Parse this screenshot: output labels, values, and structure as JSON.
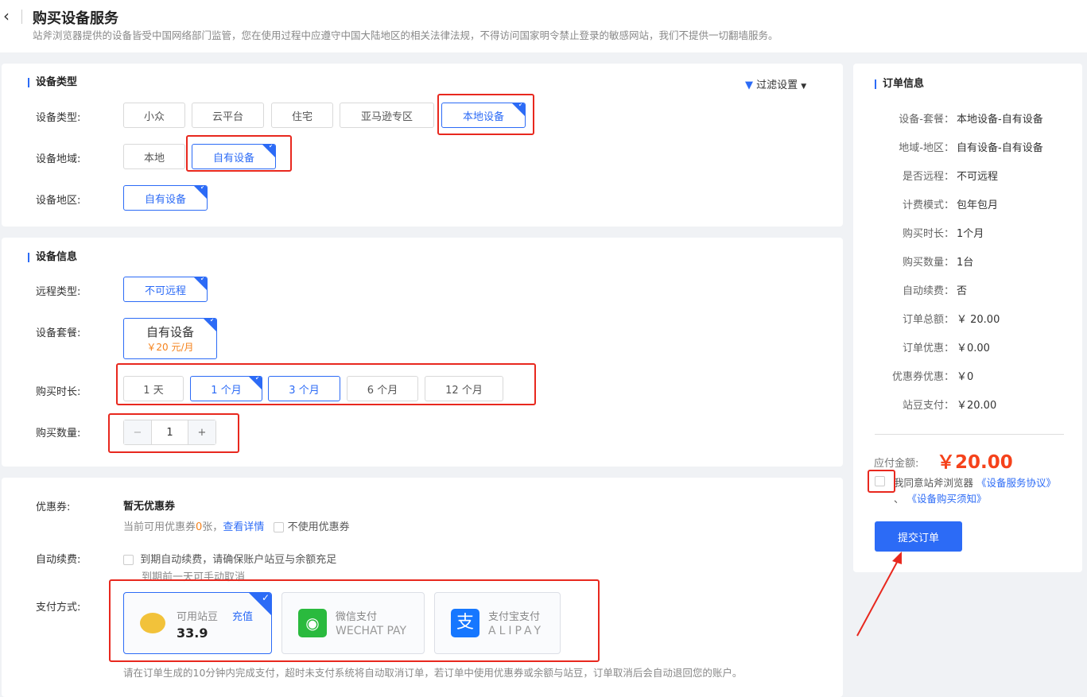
{
  "header": {
    "title": "购买设备服务",
    "notice": "站斧浏览器提供的设备皆受中国网络部门监管，您在使用过程中应遵守中国大陆地区的相关法律法规，不得访问国家明令禁止登录的敏感网站，我们不提供一切翻墙服务。"
  },
  "device_type": {
    "section": "设备类型",
    "filter": "过滤设置",
    "type_label": "设备类型:",
    "types": [
      "小众",
      "云平台",
      "住宅",
      "亚马逊专区",
      "本地设备"
    ],
    "domain_label": "设备地域:",
    "domains": [
      "本地",
      "自有设备"
    ],
    "region_label": "设备地区:",
    "regions": [
      "自有设备"
    ]
  },
  "device_info": {
    "section": "设备信息",
    "remote_label": "远程类型:",
    "remote": "不可远程",
    "package_label": "设备套餐:",
    "package_name": "自有设备",
    "package_price": "￥20 元/月",
    "duration_label": "购买时长:",
    "durations": [
      "1 天",
      "1 个月",
      "3 个月",
      "6 个月",
      "12 个月"
    ],
    "quantity_label": "购买数量:",
    "quantity": "1",
    "minus": "−",
    "plus": "+"
  },
  "payment": {
    "coupon_label": "优惠券:",
    "coupon_none": "暂无优惠券",
    "coupon_prefix": "当前可用优惠券",
    "coupon_count": "0",
    "coupon_suffix": "张，",
    "coupon_link": "查看详情",
    "no_coupon": "不使用优惠券",
    "auto_label": "自动续费:",
    "auto_text": "到期自动续费，请确保账户站豆与余额充足",
    "auto_sub": "到期前一天可手动取消",
    "method_label": "支付方式:",
    "bean_title": "可用站豆",
    "recharge": "充值",
    "bean_amount": "33.9",
    "wechat_title": "微信支付",
    "wechat_en": "WECHAT PAY",
    "alipay_title": "支付宝支付",
    "alipay_en": "ALIPAY",
    "footnote": "请在订单生成的10分钟内完成支付，超时未支付系统将自动取消订单，若订单中使用优惠券或余额与站豆，订单取消后会自动退回您的账户。"
  },
  "order": {
    "section": "订单信息",
    "rows": [
      {
        "k": "设备-套餐：",
        "v": "本地设备-自有设备"
      },
      {
        "k": "地域-地区：",
        "v": "自有设备-自有设备"
      },
      {
        "k": "是否远程：",
        "v": "不可远程"
      },
      {
        "k": "计费模式：",
        "v": "包年包月"
      },
      {
        "k": "购买时长：",
        "v": "1个月"
      },
      {
        "k": "购买数量：",
        "v": "1台"
      },
      {
        "k": "自动续费：",
        "v": "否"
      },
      {
        "k": "订单总额：",
        "v": "￥ 20.00"
      },
      {
        "k": "订单优惠：",
        "v": "￥0.00"
      },
      {
        "k": "优惠券优惠：",
        "v": "￥0"
      },
      {
        "k": "站豆支付：",
        "v": "￥20.00"
      }
    ],
    "due_label": "应付金额:",
    "due": "￥20.00",
    "agree_text": "我同意站斧浏览器",
    "agree_link1": "《设备服务协议》",
    "agree_sep": "、",
    "agree_link2": "《设备购买须知》",
    "submit": "提交订单"
  },
  "colors": {
    "accent": "#2c6bf6",
    "price": "#f5421b",
    "annotation": "#e8281e"
  }
}
